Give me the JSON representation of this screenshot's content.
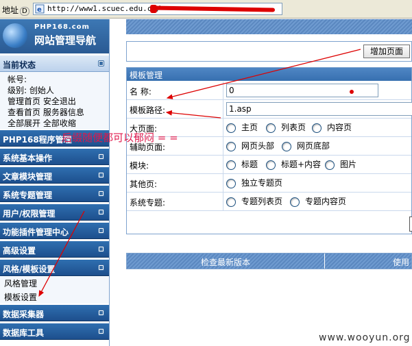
{
  "address_bar": {
    "label": "地址",
    "label_key": "D",
    "url_visible": "http://www1.scuec.edu.cn/"
  },
  "sidebar": {
    "logo": {
      "brand": "PHP168.com",
      "title": "网站管理导航"
    },
    "status_section": {
      "title": "当前状态",
      "rows": [
        "帐号:",
        "级别: 创始人",
        "管理首页  安全退出",
        "查看首页  服务器信息",
        "全部展开  全部收缩"
      ]
    },
    "sections": [
      "PHP168程序管理",
      "系统基本操作",
      "文章模块管理",
      "系统专题管理",
      "用户/权限管理",
      "功能插件管理中心",
      "高级设置",
      "风格/模板设置"
    ],
    "style_subitems": [
      "风格管理",
      "模板设置"
    ],
    "tail_sections": [
      "数据采集器",
      "数据库工具"
    ]
  },
  "main": {
    "add_page_button": "增加页面",
    "panel_title": "模板管理",
    "fields": {
      "name_label": "名 称:",
      "name_value": "0",
      "path_label": "模板路径:",
      "path_value": "1.asp",
      "big_page_label": "大页面:",
      "big_page_options": [
        "主页",
        "列表页",
        "内容页"
      ],
      "aux_page_label": "辅助页面:",
      "aux_page_options": [
        "网页头部",
        "网页底部"
      ],
      "module_label": "模块:",
      "module_options": [
        "标题",
        "标题+内容",
        "图片"
      ],
      "other_page_label": "其他页:",
      "other_page_options": [
        "独立专题页"
      ],
      "special_label": "系统专题:",
      "special_options": [
        "专题列表页",
        "专题内容页"
      ]
    },
    "bottom_bar": {
      "check_version": "检查最新版本",
      "usage": "使用"
    }
  },
  "annotation": {
    "text": "后缀随便都可以郁闷 = =",
    "color": "#e0174a"
  },
  "watermark": "www.wooyun.org",
  "colors": {
    "nav_blue": "#3770b0",
    "annotation_red": "#d00000"
  }
}
